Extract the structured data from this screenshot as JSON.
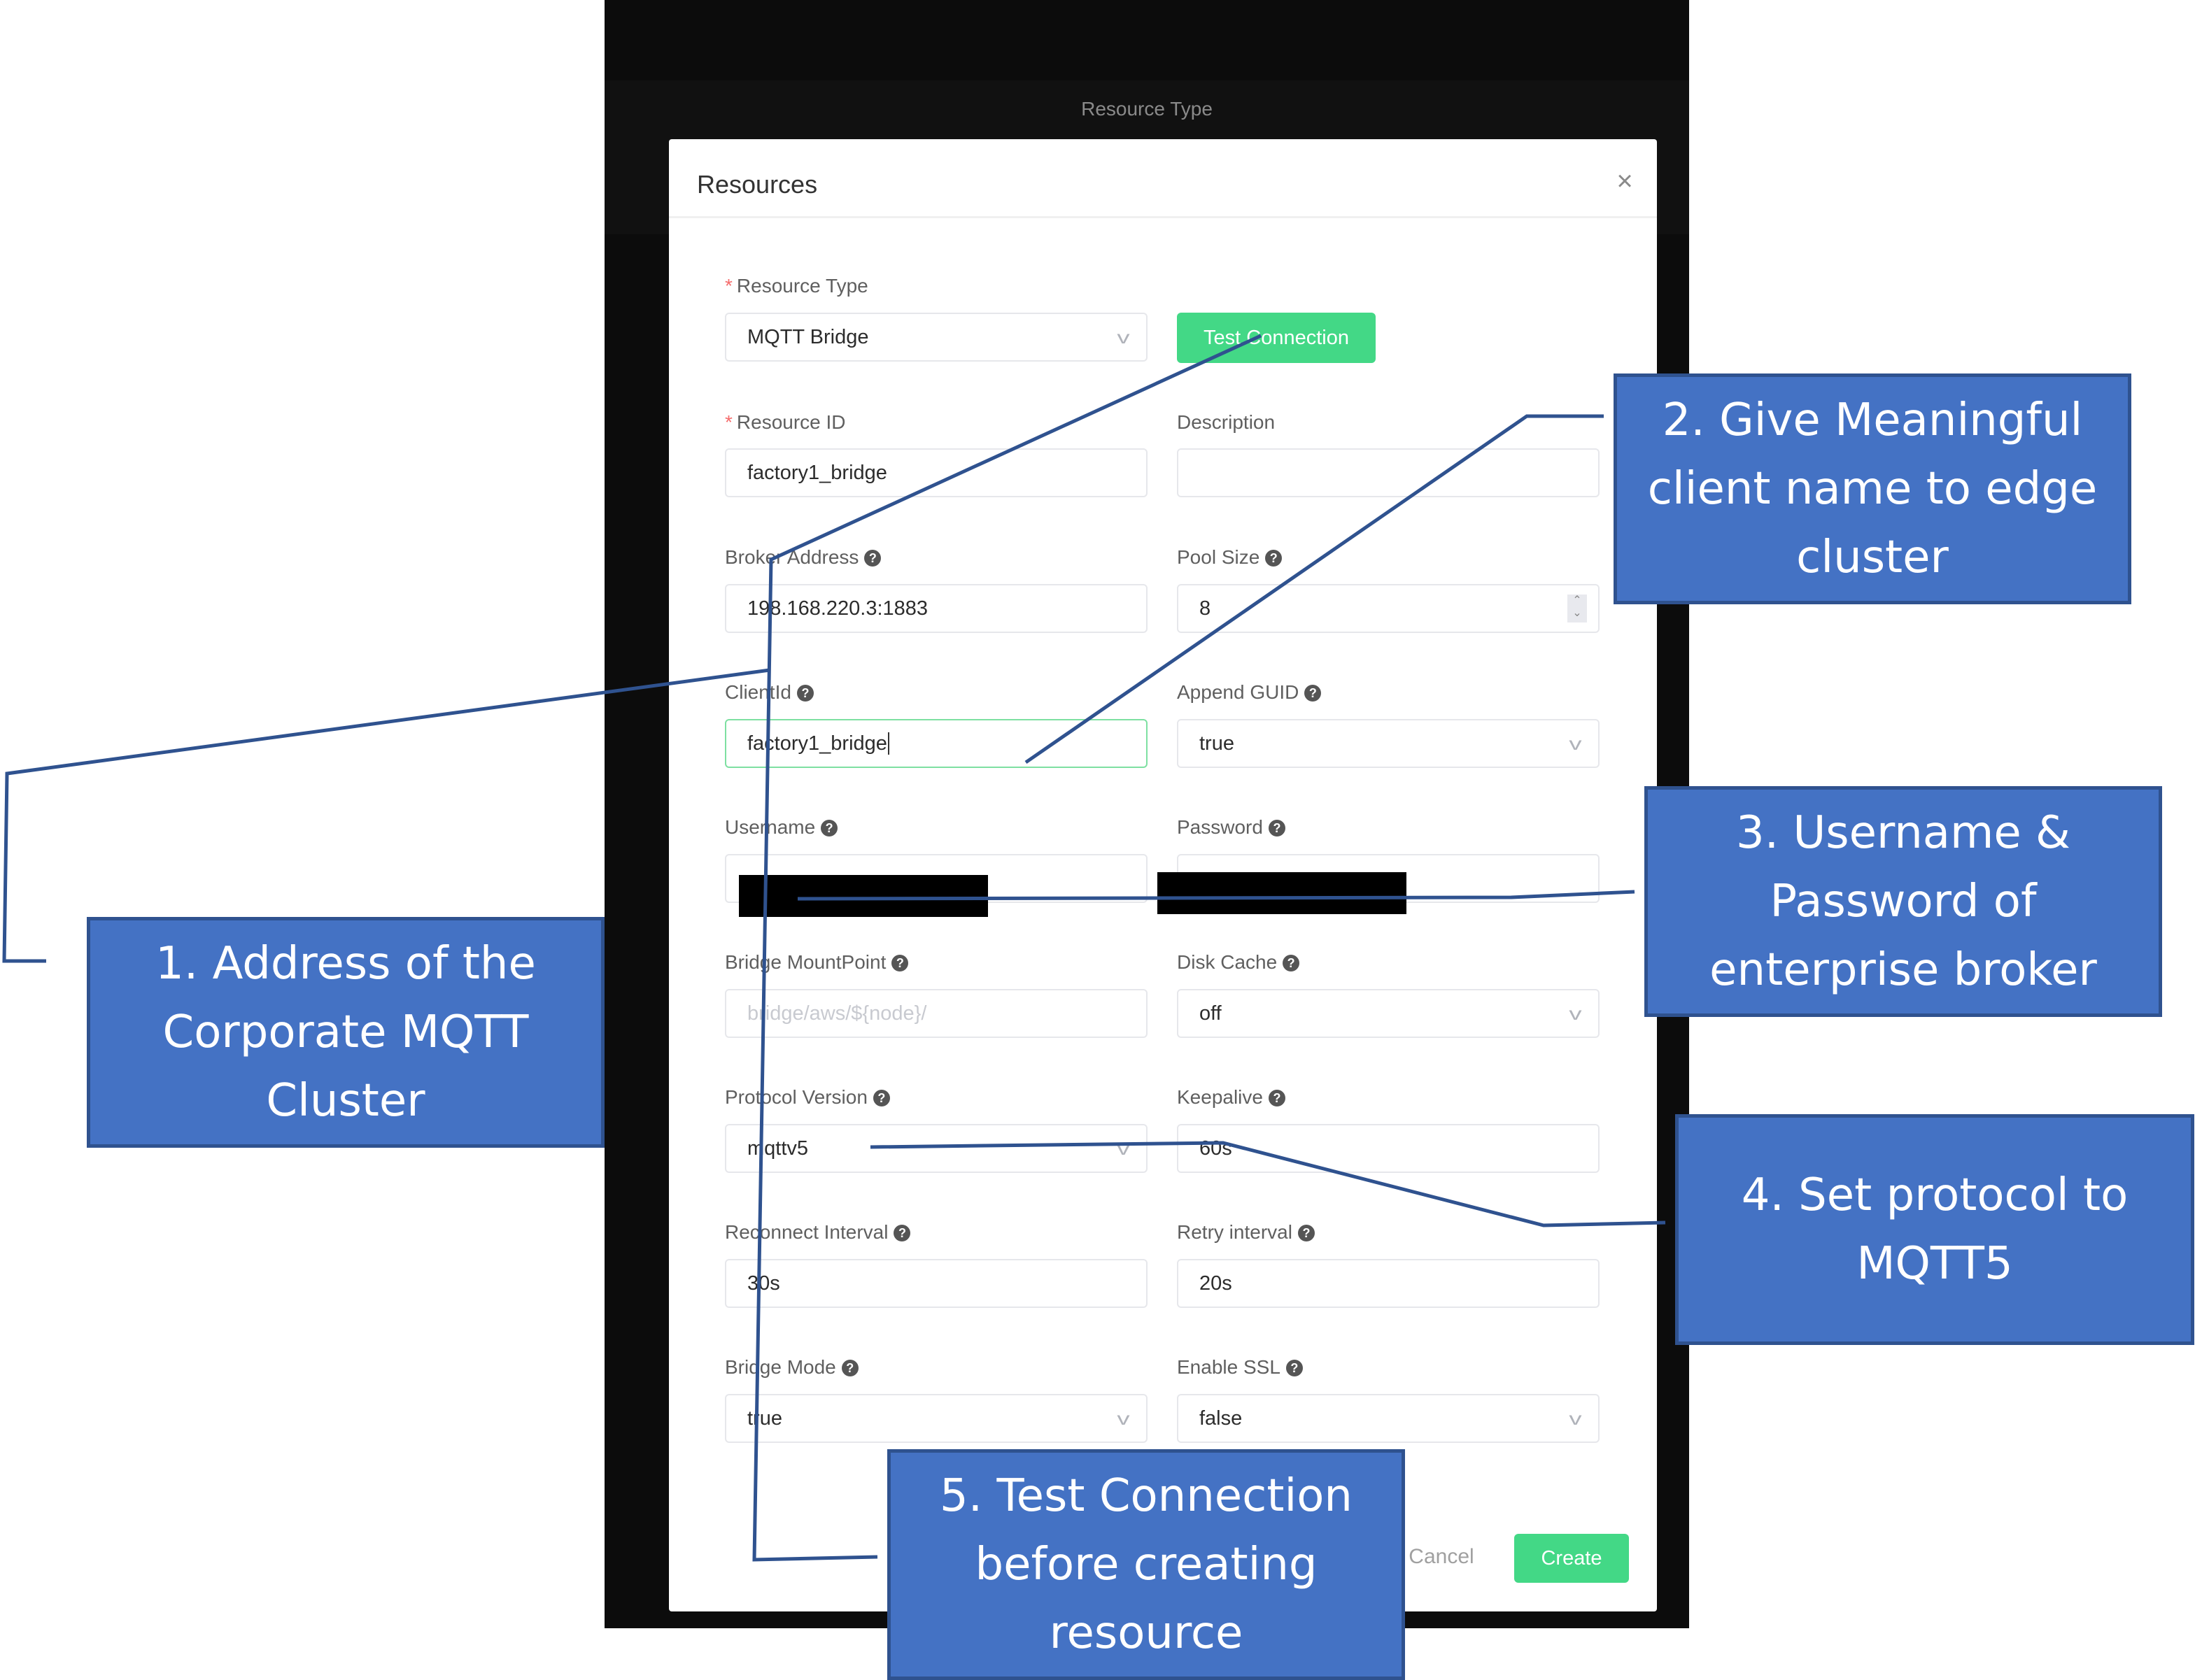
{
  "background_app": {
    "band_title": "Resource Type"
  },
  "dialog": {
    "title": "Resources",
    "close_icon": "close-icon",
    "test_connection_label": "Test Connection",
    "cancel_label": "Cancel",
    "create_label": "Create",
    "fields": [
      {
        "key": "resource_type",
        "label": "Resource Type",
        "required": true,
        "help": false,
        "type": "select",
        "value": "MQTT Bridge"
      },
      {
        "key": "resource_id",
        "label": "Resource ID",
        "required": true,
        "help": false,
        "type": "text",
        "value": "factory1_bridge"
      },
      {
        "key": "description",
        "label": "Description",
        "required": false,
        "help": false,
        "type": "text",
        "value": ""
      },
      {
        "key": "broker_address",
        "label": "Broker Address",
        "required": false,
        "help": true,
        "type": "text",
        "value": "198.168.220.3:1883"
      },
      {
        "key": "pool_size",
        "label": "Pool Size",
        "required": false,
        "help": true,
        "type": "number",
        "value": "8"
      },
      {
        "key": "client_id",
        "label": "ClientId",
        "required": false,
        "help": true,
        "type": "text",
        "value": "factory1_bridge",
        "focused": true
      },
      {
        "key": "append_guid",
        "label": "Append GUID",
        "required": false,
        "help": true,
        "type": "select",
        "value": "true"
      },
      {
        "key": "username",
        "label": "Username",
        "required": false,
        "help": true,
        "type": "text",
        "value": "",
        "redacted": true
      },
      {
        "key": "password",
        "label": "Password",
        "required": false,
        "help": true,
        "type": "password",
        "value": "",
        "redacted": true
      },
      {
        "key": "bridge_mountpoint",
        "label": "Bridge MountPoint",
        "required": false,
        "help": true,
        "type": "text",
        "value": "",
        "placeholder": "bridge/aws/${node}/"
      },
      {
        "key": "disk_cache",
        "label": "Disk Cache",
        "required": false,
        "help": true,
        "type": "select",
        "value": "off"
      },
      {
        "key": "protocol_version",
        "label": "Protocol Version",
        "required": false,
        "help": true,
        "type": "select",
        "value": "mqttv5"
      },
      {
        "key": "keepalive",
        "label": "Keepalive",
        "required": false,
        "help": true,
        "type": "text",
        "value": "60s"
      },
      {
        "key": "reconnect_interval",
        "label": "Reconnect Interval",
        "required": false,
        "help": true,
        "type": "text",
        "value": "30s"
      },
      {
        "key": "retry_interval",
        "label": "Retry interval",
        "required": false,
        "help": true,
        "type": "text",
        "value": "20s"
      },
      {
        "key": "bridge_mode",
        "label": "Bridge Mode",
        "required": false,
        "help": true,
        "type": "select",
        "value": "true"
      },
      {
        "key": "enable_ssl",
        "label": "Enable SSL",
        "required": false,
        "help": true,
        "type": "select",
        "value": "false"
      }
    ]
  },
  "callouts": [
    {
      "number": 1,
      "text": "1. Address of the Corporate MQTT Cluster"
    },
    {
      "number": 2,
      "text": "2. Give Meaningful client name to edge cluster"
    },
    {
      "number": 3,
      "text": "3. Username & Password of enterprise broker"
    },
    {
      "number": 4,
      "text": "4. Set protocol to MQTT5"
    },
    {
      "number": 5,
      "text": "5. Test Connection before creating resource"
    }
  ],
  "colors": {
    "primary_green": "#43d886",
    "callout_fill": "#4472c4",
    "callout_border": "#2f528f",
    "required_star": "#f56c6c",
    "app_background": "#0c0c0c"
  }
}
